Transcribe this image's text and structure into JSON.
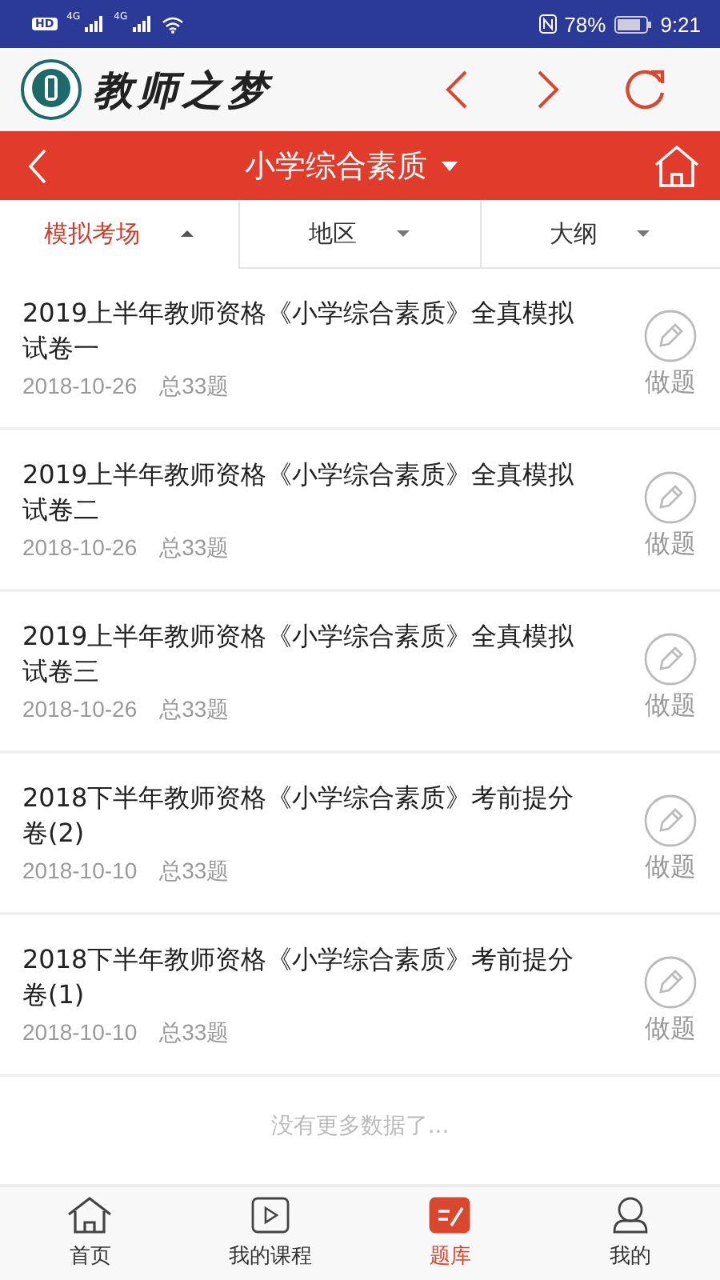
{
  "status_bar": {
    "badge": "HD",
    "networks": [
      "4G",
      "4G"
    ],
    "battery": "78%",
    "time": "9:21"
  },
  "header": {
    "logo_text": "教师之梦"
  },
  "title_bar": {
    "title": "小学综合素质"
  },
  "filters": [
    {
      "label": "模拟考场",
      "selected": true,
      "expanded": true
    },
    {
      "label": "地区",
      "selected": false,
      "expanded": false
    },
    {
      "label": "大纲",
      "selected": false,
      "expanded": false
    }
  ],
  "papers": [
    {
      "title": "2019上半年教师资格《小学综合素质》全真模拟试卷一",
      "date": "2018-10-26",
      "count": "总33题",
      "action": "做题"
    },
    {
      "title": "2019上半年教师资格《小学综合素质》全真模拟试卷二",
      "date": "2018-10-26",
      "count": "总33题",
      "action": "做题"
    },
    {
      "title": "2019上半年教师资格《小学综合素质》全真模拟试卷三",
      "date": "2018-10-26",
      "count": "总33题",
      "action": "做题"
    },
    {
      "title": "2018下半年教师资格《小学综合素质》考前提分卷(2)",
      "date": "2018-10-10",
      "count": "总33题",
      "action": "做题"
    },
    {
      "title": "2018下半年教师资格《小学综合素质》考前提分卷(1)",
      "date": "2018-10-10",
      "count": "总33题",
      "action": "做题"
    }
  ],
  "end_note": "没有更多数据了...",
  "nav": [
    {
      "kind": "home",
      "label": "首页",
      "selected": false
    },
    {
      "kind": "course",
      "label": "我的课程",
      "selected": false
    },
    {
      "kind": "bank",
      "label": "题库",
      "selected": true
    },
    {
      "kind": "me",
      "label": "我的",
      "selected": false
    }
  ]
}
